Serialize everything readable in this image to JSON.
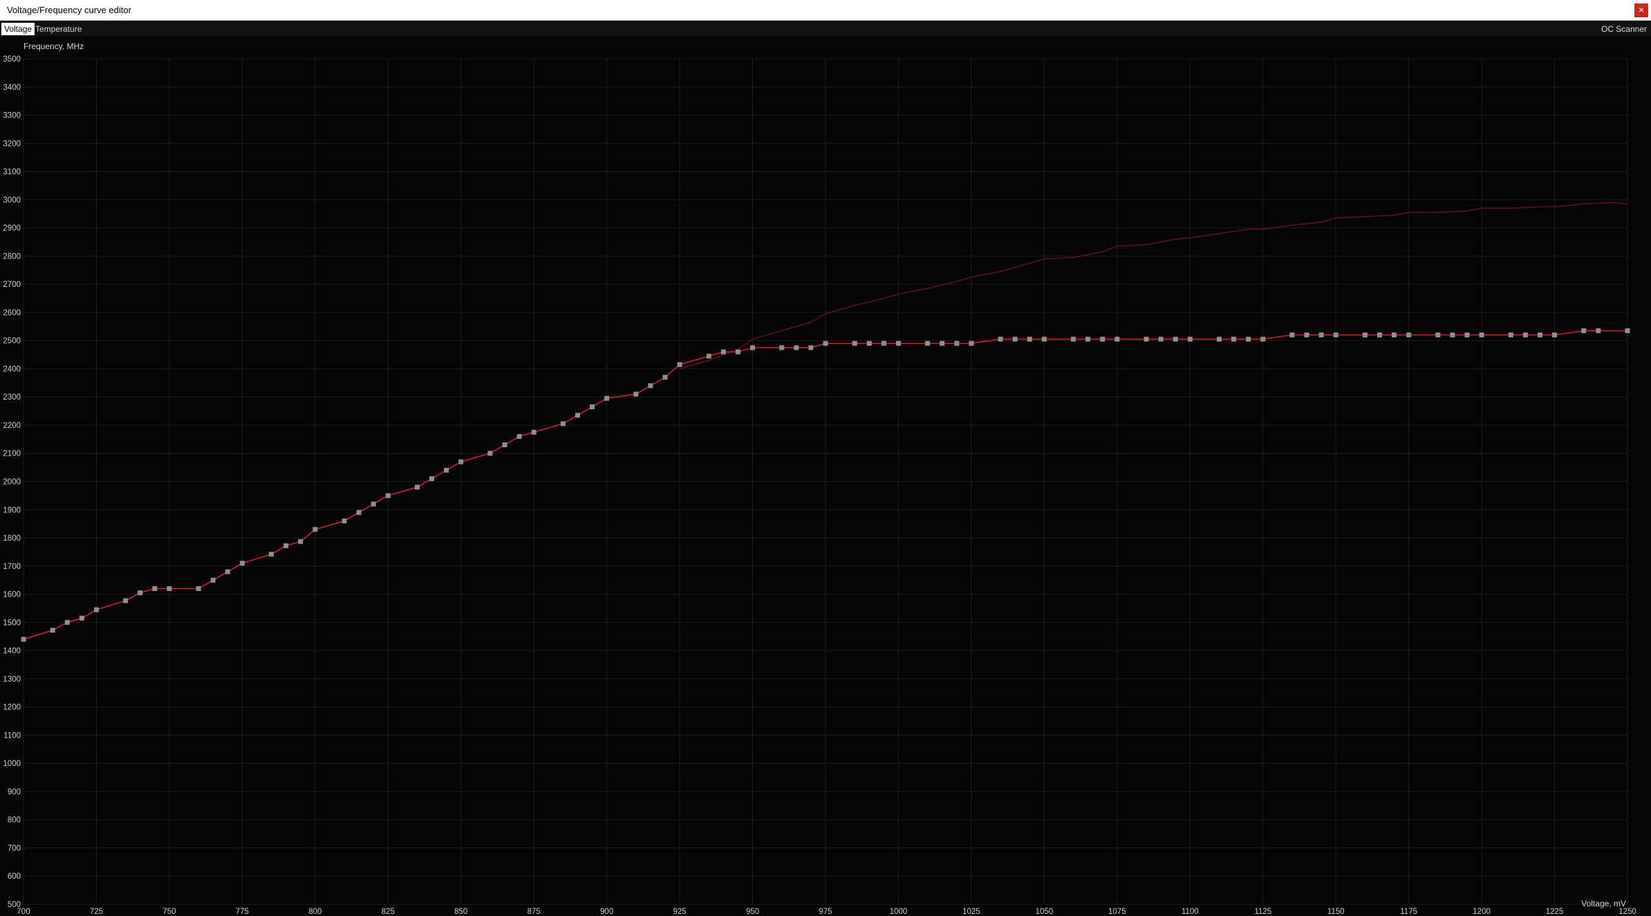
{
  "window": {
    "title": "Voltage/Frequency curve editor",
    "close_label": "×"
  },
  "tabs": [
    {
      "label": "Voltage",
      "active": true
    },
    {
      "label": "Temperature",
      "active": false
    }
  ],
  "oc_scanner_label": "OC Scanner",
  "colors": {
    "background": "#050505",
    "grid": "#1e1e1e",
    "curve": "#c8232a",
    "reference_curve": "#5a1417",
    "point": "#8f8f8f",
    "close_button": "#c42b1c"
  },
  "chart_data": {
    "type": "line",
    "title": "",
    "xlabel": "Voltage, mV",
    "ylabel": "Frequency, MHz",
    "xlim": [
      700,
      1250
    ],
    "ylim": [
      500,
      3500
    ],
    "xticks": [
      700,
      725,
      750,
      775,
      800,
      825,
      850,
      875,
      900,
      925,
      950,
      975,
      1000,
      1025,
      1050,
      1075,
      1100,
      1125,
      1150,
      1175,
      1200,
      1225,
      1250
    ],
    "yticks": [
      500,
      600,
      700,
      800,
      900,
      1000,
      1100,
      1200,
      1300,
      1400,
      1500,
      1600,
      1700,
      1800,
      1900,
      2000,
      2100,
      2200,
      2300,
      2400,
      2500,
      2600,
      2700,
      2800,
      2900,
      3000,
      3100,
      3200,
      3300,
      3400,
      3500
    ],
    "grid": true,
    "series": [
      {
        "role": "curve",
        "x": [
          700,
          710,
          715,
          720,
          725,
          735,
          740,
          745,
          750,
          760,
          765,
          770,
          775,
          785,
          790,
          795,
          800,
          810,
          815,
          820,
          825,
          835,
          840,
          845,
          850,
          860,
          865,
          870,
          875,
          885,
          890,
          895,
          900,
          910,
          915,
          920,
          925,
          935,
          940,
          945,
          950,
          960,
          965,
          970,
          975,
          985,
          990,
          995,
          1000,
          1010,
          1015,
          1020,
          1025,
          1035,
          1040,
          1045,
          1050,
          1060,
          1065,
          1070,
          1075,
          1085,
          1090,
          1095,
          1100,
          1110,
          1115,
          1120,
          1125,
          1135,
          1140,
          1145,
          1150,
          1160,
          1165,
          1170,
          1175,
          1185,
          1190,
          1195,
          1200,
          1210,
          1215,
          1220,
          1225,
          1235,
          1240,
          1250
        ],
        "y": [
          1440,
          1472,
          1500,
          1515,
          1545,
          1577,
          1605,
          1620,
          1620,
          1620,
          1650,
          1680,
          1710,
          1742,
          1772,
          1787,
          1830,
          1860,
          1890,
          1920,
          1950,
          1980,
          2010,
          2040,
          2070,
          2100,
          2130,
          2160,
          2175,
          2205,
          2235,
          2265,
          2295,
          2310,
          2340,
          2370,
          2415,
          2445,
          2460,
          2460,
          2475,
          2475,
          2475,
          2475,
          2490,
          2490,
          2490,
          2490,
          2490,
          2490,
          2490,
          2490,
          2490,
          2505,
          2505,
          2505,
          2505,
          2505,
          2505,
          2505,
          2505,
          2505,
          2505,
          2505,
          2505,
          2505,
          2505,
          2505,
          2505,
          2520,
          2520,
          2520,
          2520,
          2520,
          2520,
          2520,
          2520,
          2520,
          2520,
          2520,
          2520,
          2520,
          2520,
          2520,
          2520,
          2535,
          2535,
          2535
        ]
      },
      {
        "role": "reference",
        "x": [
          925,
          935,
          945,
          950,
          960,
          970,
          975,
          985,
          995,
          1000,
          1010,
          1020,
          1025,
          1035,
          1045,
          1050,
          1060,
          1070,
          1075,
          1085,
          1095,
          1100,
          1110,
          1120,
          1125,
          1135,
          1145,
          1150,
          1160,
          1170,
          1175,
          1185,
          1195,
          1200,
          1210,
          1220,
          1225,
          1235,
          1245,
          1250
        ],
        "y": [
          2400,
          2430,
          2470,
          2505,
          2535,
          2565,
          2595,
          2625,
          2650,
          2665,
          2685,
          2710,
          2725,
          2745,
          2775,
          2790,
          2795,
          2815,
          2835,
          2840,
          2860,
          2865,
          2880,
          2895,
          2895,
          2910,
          2920,
          2935,
          2940,
          2945,
          2955,
          2955,
          2960,
          2970,
          2970,
          2975,
          2975,
          2985,
          2990,
          2985
        ]
      }
    ]
  }
}
